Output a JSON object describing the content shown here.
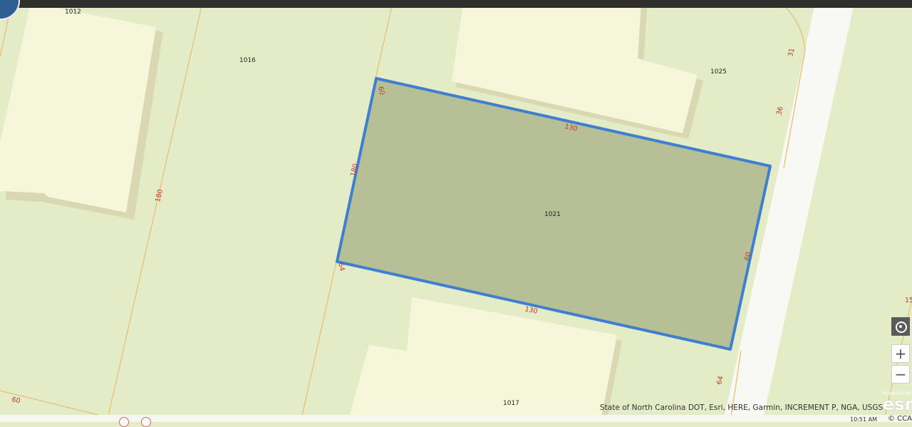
{
  "map": {
    "lots": [
      "1012",
      "1016",
      "1025",
      "1021",
      "1017"
    ],
    "dims": [
      "60",
      "180",
      "180",
      "130",
      "130",
      "60",
      "64",
      "64",
      "36",
      "31",
      "60",
      "15"
    ]
  },
  "attribution": "State of North Carolina DOT, Esri, HERE, Garmin, INCREMENT P, NGA, USGS",
  "esri_logo": {
    "powered_by": "POWERED BY",
    "word": "esri"
  },
  "time": "10:51 AM",
  "copyright": "© CCAR",
  "controls": {
    "locate_icon": "locate-icon",
    "zoom_in": "+",
    "zoom_out": "−"
  },
  "colors": {
    "parcel_outline": "#3f7fd0",
    "parcel_fill": "#b7bf96",
    "building": "#f6f6da",
    "land": "#e4ebc7"
  }
}
